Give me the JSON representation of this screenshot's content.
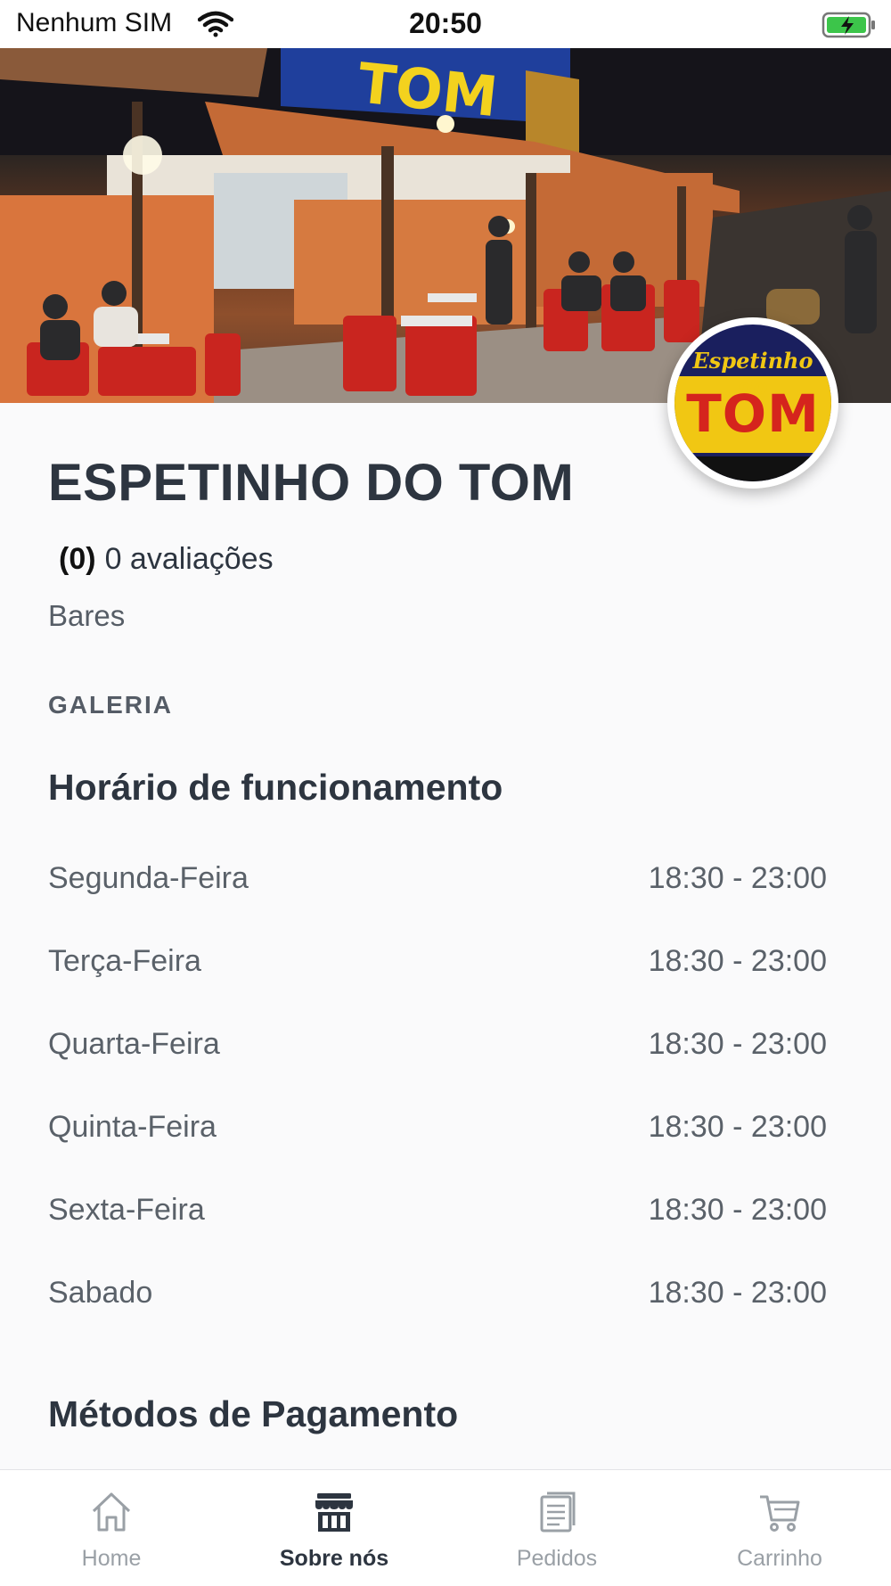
{
  "status_bar": {
    "carrier": "Nenhum SIM",
    "time": "20:50",
    "icons": [
      "wifi-icon",
      "battery-charging-icon"
    ]
  },
  "hero": {
    "image": "restaurant-storefront-night-photo",
    "sign_text": "TOM"
  },
  "logo": {
    "top_text": "Espetinho do",
    "main_text": "TOM",
    "colors": {
      "background": "#1a1f5e",
      "band": "#f1c713",
      "text": "#d5241d"
    }
  },
  "restaurant": {
    "name": "ESPETINHO DO TOM",
    "rating": "(0)",
    "reviews": "0 avaliações",
    "category": "Bares"
  },
  "gallery_label": "GALERIA",
  "hours": {
    "title": "Horário de funcionamento",
    "rows": [
      {
        "day": "Segunda-Feira",
        "time": "18:30 - 23:00"
      },
      {
        "day": "Terça-Feira",
        "time": "18:30 - 23:00"
      },
      {
        "day": "Quarta-Feira",
        "time": "18:30 - 23:00"
      },
      {
        "day": "Quinta-Feira",
        "time": "18:30 - 23:00"
      },
      {
        "day": "Sexta-Feira",
        "time": "18:30 - 23:00"
      },
      {
        "day": "Sabado",
        "time": "18:30 - 23:00"
      }
    ]
  },
  "payment": {
    "title": "Métodos de Pagamento"
  },
  "tabbar": {
    "items": [
      {
        "label": "Home",
        "icon": "home-icon",
        "active": false
      },
      {
        "label": "Sobre nós",
        "icon": "store-icon",
        "active": true
      },
      {
        "label": "Pedidos",
        "icon": "orders-icon",
        "active": false
      },
      {
        "label": "Carrinho",
        "icon": "cart-icon",
        "active": false
      }
    ]
  },
  "colors": {
    "accent": "#2d3540",
    "inactive": "#9aa0a6"
  }
}
